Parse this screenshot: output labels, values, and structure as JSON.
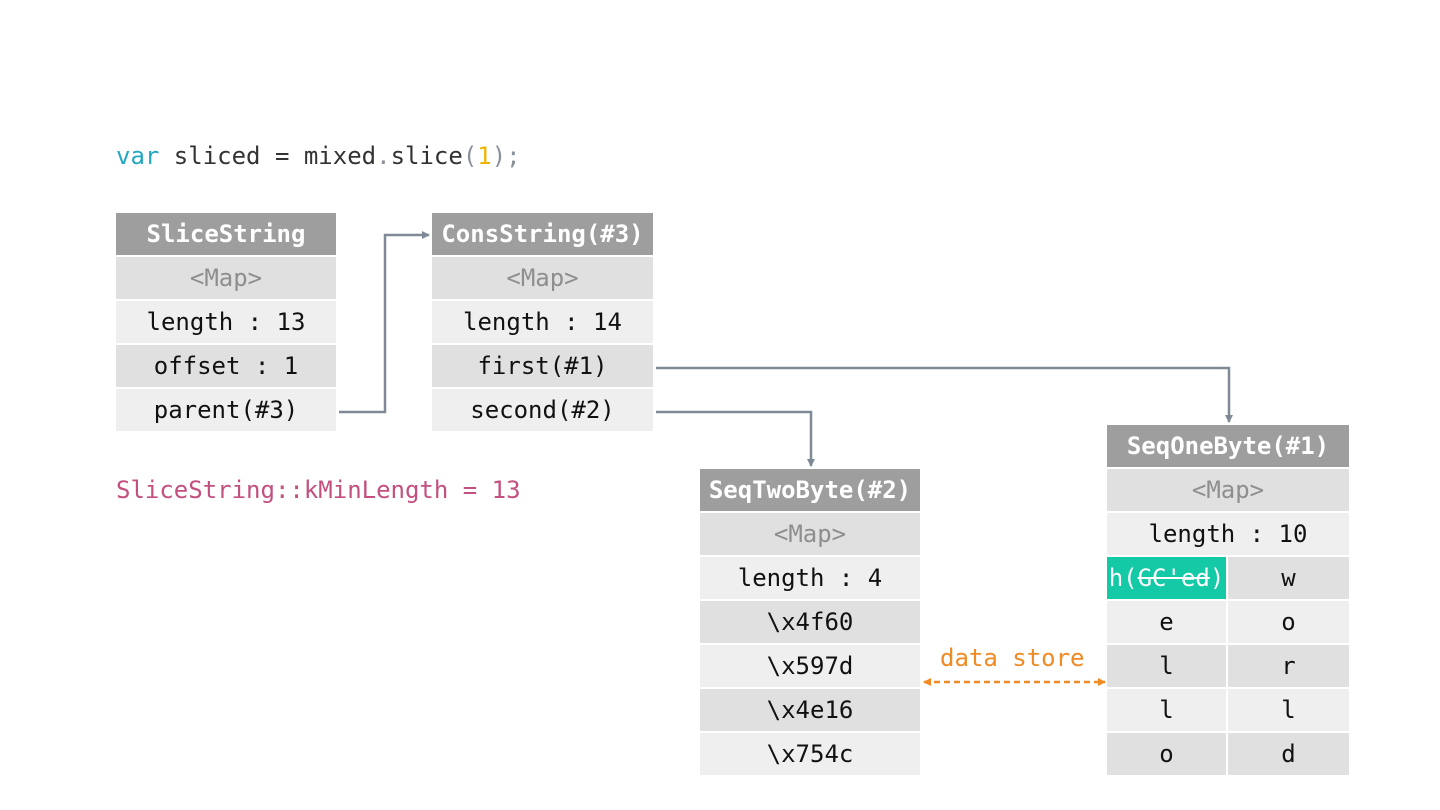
{
  "code": {
    "keyword": "var",
    "rest_before_call": " sliced = mixed",
    "dot": ".",
    "method": "slice",
    "open_paren": "(",
    "arg": "1",
    "close": ");"
  },
  "constant_note": "SliceString::kMinLength = 13",
  "slice_string": {
    "title": "SliceString",
    "rows": [
      "<Map>",
      "length : 13",
      "offset : 1",
      "parent(#3)"
    ]
  },
  "cons_string": {
    "title": "ConsString(#3)",
    "rows": [
      "<Map>",
      "length : 14",
      "first(#1)",
      "second(#2)"
    ]
  },
  "seq_two_byte": {
    "title": "SeqTwoByte(#2)",
    "rows": [
      "<Map>",
      "length : 4",
      "\\x4f60",
      "\\x597d",
      "\\x4e16",
      "\\x754c"
    ]
  },
  "seq_one_byte": {
    "title": "SeqOneByte(#1)",
    "map": "<Map>",
    "length": "length : 10",
    "gc_cell": {
      "char": "h",
      "open": "(",
      "gc": "GC'ed",
      "close": ")"
    },
    "gc_right": "w",
    "pairs": [
      [
        "e",
        "o"
      ],
      [
        "l",
        "r"
      ],
      [
        "l",
        "l"
      ],
      [
        "o",
        "d"
      ]
    ]
  },
  "link_label": "data store",
  "colors": {
    "header_bg": "#9e9e9e",
    "row_dark": "#e0e0e0",
    "row_light": "#efefef",
    "keyword": "#23a8c2",
    "number": "#f0b400",
    "constant": "#c3507f",
    "gc_highlight": "#14c9a6",
    "data_store": "#f08a24",
    "arrow": "#7f8a96"
  }
}
